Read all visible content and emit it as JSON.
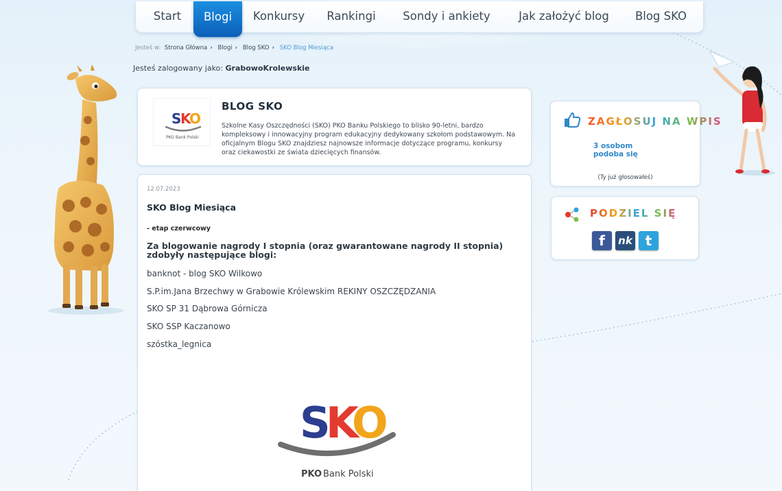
{
  "nav": {
    "items": [
      "Start",
      "Blogi",
      "Konkursy",
      "Rankingi",
      "Sondy i ankiety",
      "Jak założyć blog",
      "Blog SKO"
    ],
    "active_index": 1
  },
  "breadcrumb": {
    "prefix": "Jesteś w:",
    "items": [
      "Strona Główna",
      "Blogi",
      "Blog SKO",
      "SKO Blog Miesiąca"
    ]
  },
  "user": {
    "label": "Jesteś zalogowany jako:",
    "name": "GrabowoKrolewskie"
  },
  "blog": {
    "title": "BLOG SKO",
    "description": "Szkolne Kasy Oszczędności (SKO) PKO Banku Polskiego to blisko 90-letni, bardzo kompleksowy i innowacyjny program edukacyjny dedykowany szkołom podstawowym. Na oficjalnym Blogu SKO znajdziesz najnowsze informacje dotyczące programu, konkursy oraz ciekawostki ze świata dziecięcych finansów.",
    "logo": {
      "word": "SKO",
      "bank": "PKO Bank Polski"
    }
  },
  "post": {
    "date": "12.07.2023",
    "title": "SKO Blog Miesiąca",
    "subtitle": "- etap czerwcowy",
    "lead": "Za blogowanie nagrody I stopnia (oraz gwarantowane nagrody II stopnia) zdobyły następujące blogi:",
    "winners": [
      "banknot - blog SKO Wilkowo",
      "S.P.im.Jana Brzechwy w Grabowie Królewskim REKINY OSZCZĘDZANIA",
      "SKO SP 31 Dąbrowa Górnicza",
      "SKO SSP Kaczanowo",
      "szóstka_legnica"
    ],
    "image": {
      "word": "SKO",
      "bank_prefix": "PKO",
      "bank_suffix": "Bank Polski"
    }
  },
  "vote": {
    "title": "ZAGŁOSUJ NA WPIS",
    "count_line1": "3 osobom",
    "count_line2": "podoba się",
    "note": "(Ty już głosowałeś)"
  },
  "share": {
    "title": "PODZIEL SIĘ",
    "buttons": [
      {
        "name": "facebook",
        "glyph": "f",
        "color": "#3b5998"
      },
      {
        "name": "nk",
        "glyph": "nk",
        "color": "#2a4f7a"
      },
      {
        "name": "twitter",
        "glyph": "t",
        "color": "#2fa3dc"
      }
    ]
  },
  "colors": {
    "accent": "#0b6fc6",
    "sko_s": "#2c3e8f",
    "sko_k": "#e43a2f",
    "sko_o": "#f2a51a",
    "vote_title": [
      "#f2542d",
      "#f7a21b",
      "#2fa3dc",
      "#7cc04b",
      "#e2457d"
    ]
  }
}
